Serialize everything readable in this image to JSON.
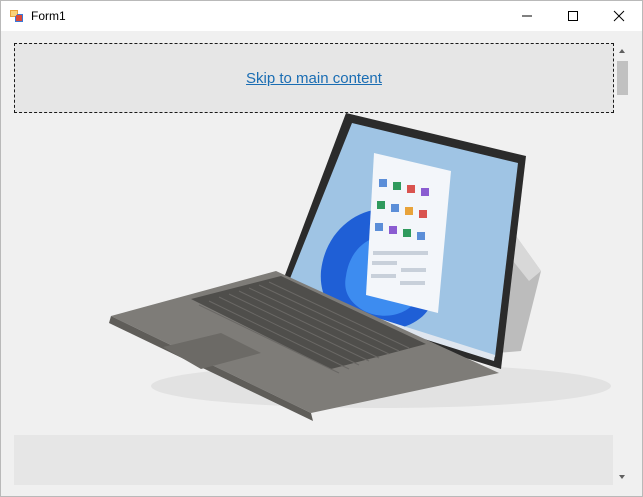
{
  "window": {
    "title": "Form1",
    "controls": {
      "minimize": "minimize-icon",
      "maximize": "maximize-icon",
      "close": "close-icon"
    }
  },
  "content": {
    "skip_link": "Skip to main content",
    "hero_image": "surface-laptop-tablet-image"
  },
  "colors": {
    "link": "#1a6db3",
    "panel": "#e6e6e6",
    "background": "#f0f0f0"
  }
}
